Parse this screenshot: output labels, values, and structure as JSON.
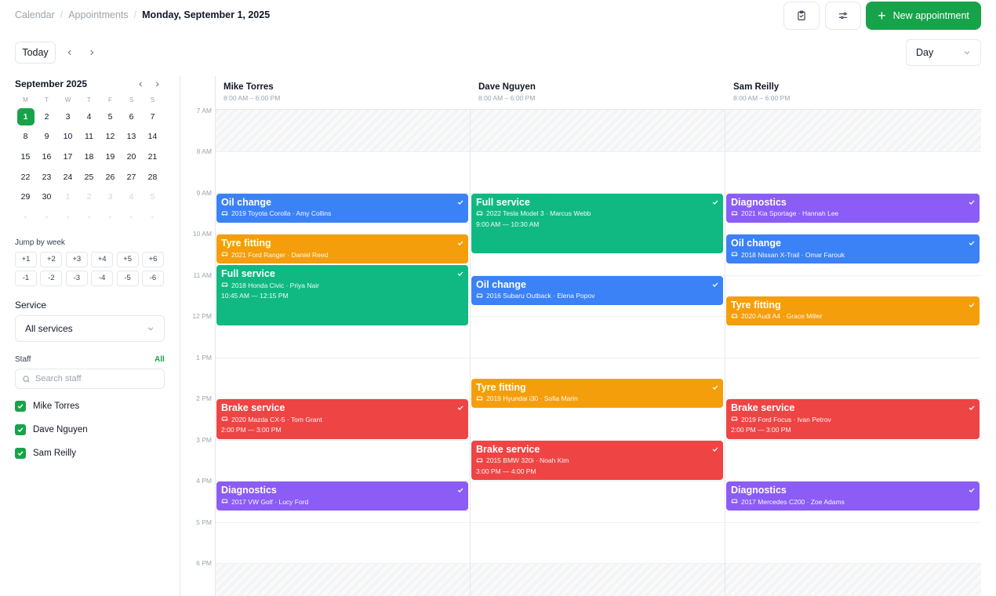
{
  "breadcrumb": {
    "calendar": "Calendar",
    "appointments": "Appointments",
    "current": "Monday, September 1, 2025"
  },
  "toolbar": {
    "new_label": "New appointment",
    "today_label": "Today",
    "view": "Day"
  },
  "colors": {
    "accent": "#16a34a",
    "blue": "#3b82f6",
    "amber": "#f59e0b",
    "green": "#10b981",
    "red": "#ef4444",
    "purple": "#8b5cf6"
  },
  "mini_calendar": {
    "title": "September 2025",
    "weekdays": [
      "M",
      "T",
      "W",
      "T",
      "F",
      "S",
      "S"
    ],
    "selected_day": "1",
    "weeks": [
      [
        "1",
        "2",
        "3",
        "4",
        "5",
        "6",
        "7"
      ],
      [
        "8",
        "9",
        "10",
        "11",
        "12",
        "13",
        "14"
      ],
      [
        "15",
        "16",
        "17",
        "18",
        "19",
        "20",
        "21"
      ],
      [
        "22",
        "23",
        "24",
        "25",
        "26",
        "27",
        "28"
      ],
      [
        "29",
        "30",
        "1",
        "2",
        "3",
        "4",
        "5"
      ]
    ]
  },
  "jump": {
    "label": "Jump by week",
    "buttons": [
      "+1",
      "+2",
      "+3",
      "+4",
      "+5",
      "+6",
      "-1",
      "-2",
      "-3",
      "-4",
      "-5",
      "-6"
    ]
  },
  "service": {
    "label": "Service",
    "value": "All services"
  },
  "staff": {
    "label": "Staff",
    "all_label": "All",
    "search_placeholder": "Search staff",
    "members": [
      "Mike Torres",
      "Dave Nguyen",
      "Sam Reilly"
    ]
  },
  "schedule": {
    "time_labels": [
      "7 AM",
      "8 AM",
      "9 AM",
      "10 AM",
      "11 AM",
      "12 PM",
      "1 PM",
      "2 PM",
      "3 PM",
      "4 PM",
      "5 PM",
      "6 PM"
    ],
    "columns": [
      {
        "name": "Mike Torres",
        "hours": "8:00 AM – 6:00 PM"
      },
      {
        "name": "Dave Nguyen",
        "hours": "8:00 AM – 6:00 PM"
      },
      {
        "name": "Sam Reilly",
        "hours": "8:00 AM – 6:00 PM"
      }
    ],
    "appointments": [
      {
        "col": 0,
        "start": 9.0,
        "end": 9.75,
        "color": "blue",
        "title": "Oil change",
        "detail": "2019 Toyota Corolla · Amy Collins",
        "time": ""
      },
      {
        "col": 0,
        "start": 10.0,
        "end": 10.75,
        "color": "amber",
        "title": "Tyre fitting",
        "detail": "2021 Ford Ranger · Daniel Reed",
        "time": ""
      },
      {
        "col": 0,
        "start": 10.75,
        "end": 12.25,
        "color": "green",
        "title": "Full service",
        "detail": "2018 Honda Civic · Priya Nair",
        "time": "10:45 AM — 12:15 PM"
      },
      {
        "col": 0,
        "start": 14.0,
        "end": 15.0,
        "color": "red",
        "title": "Brake service",
        "detail": "2020 Mazda CX-5 · Tom Grant",
        "time": "2:00 PM — 3:00 PM"
      },
      {
        "col": 0,
        "start": 16.0,
        "end": 16.75,
        "color": "purple",
        "title": "Diagnostics",
        "detail": "2017 VW Golf · Lucy Ford",
        "time": ""
      },
      {
        "col": 1,
        "start": 9.0,
        "end": 10.5,
        "color": "green",
        "title": "Full service",
        "detail": "2022 Tesla Model 3 · Marcus Webb",
        "time": "9:00 AM — 10:30 AM"
      },
      {
        "col": 1,
        "start": 11.0,
        "end": 11.75,
        "color": "blue",
        "title": "Oil change",
        "detail": "2016 Subaru Outback · Elena Popov",
        "time": ""
      },
      {
        "col": 1,
        "start": 13.5,
        "end": 14.25,
        "color": "amber",
        "title": "Tyre fitting",
        "detail": "2019 Hyundai i30 · Sofia Marin",
        "time": ""
      },
      {
        "col": 1,
        "start": 15.0,
        "end": 16.0,
        "color": "red",
        "title": "Brake service",
        "detail": "2015 BMW 320i · Noah Kim",
        "time": "3:00 PM — 4:00 PM"
      },
      {
        "col": 2,
        "start": 9.0,
        "end": 9.75,
        "color": "purple",
        "title": "Diagnostics",
        "detail": "2021 Kia Sportage · Hannah Lee",
        "time": ""
      },
      {
        "col": 2,
        "start": 10.0,
        "end": 10.75,
        "color": "blue",
        "title": "Oil change",
        "detail": "2018 Nissan X-Trail · Omar Farouk",
        "time": ""
      },
      {
        "col": 2,
        "start": 11.5,
        "end": 12.25,
        "color": "amber",
        "title": "Tyre fitting",
        "detail": "2020 Audi A4 · Grace Miller",
        "time": ""
      },
      {
        "col": 2,
        "start": 14.0,
        "end": 15.0,
        "color": "red",
        "title": "Brake service",
        "detail": "2019 Ford Focus · Ivan Petrov",
        "time": "2:00 PM — 3:00 PM"
      },
      {
        "col": 2,
        "start": 16.0,
        "end": 16.75,
        "color": "purple",
        "title": "Diagnostics",
        "detail": "2017 Mercedes C200 · Zoe Adams",
        "time": ""
      }
    ]
  }
}
